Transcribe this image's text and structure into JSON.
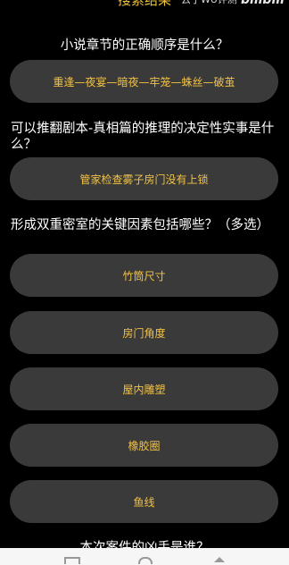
{
  "header": {
    "search_result_label": "搜索结果",
    "watermark": "云子WU评测",
    "logo": "bilibili"
  },
  "questions": [
    {
      "text": "小说章节的正确顺序是什么？",
      "options": [
        "重逢—夜宴—暗夜—牢笼—蛛丝—破茧"
      ]
    },
    {
      "text": "可以推翻剧本-真相篇的推理的决定性实事是什么？",
      "options": [
        "管家检查雾子房门没有上锁"
      ]
    },
    {
      "text": "形成双重密室的关键因素包括哪些？（多选）",
      "options": [
        "竹筒尺寸",
        "房门角度",
        "屋内雕塑",
        "橡胶圈",
        "鱼线"
      ]
    },
    {
      "text": "本次案件的凶手是谁？",
      "options": []
    }
  ],
  "colors": {
    "background": "#000000",
    "option_background": "#3a3a3a",
    "option_text": "#f2c244",
    "question_text": "#ffffff",
    "nav_bar": "#f6f6f6"
  },
  "nav_icons": [
    "home-icon",
    "circle-icon",
    "back-icon"
  ]
}
